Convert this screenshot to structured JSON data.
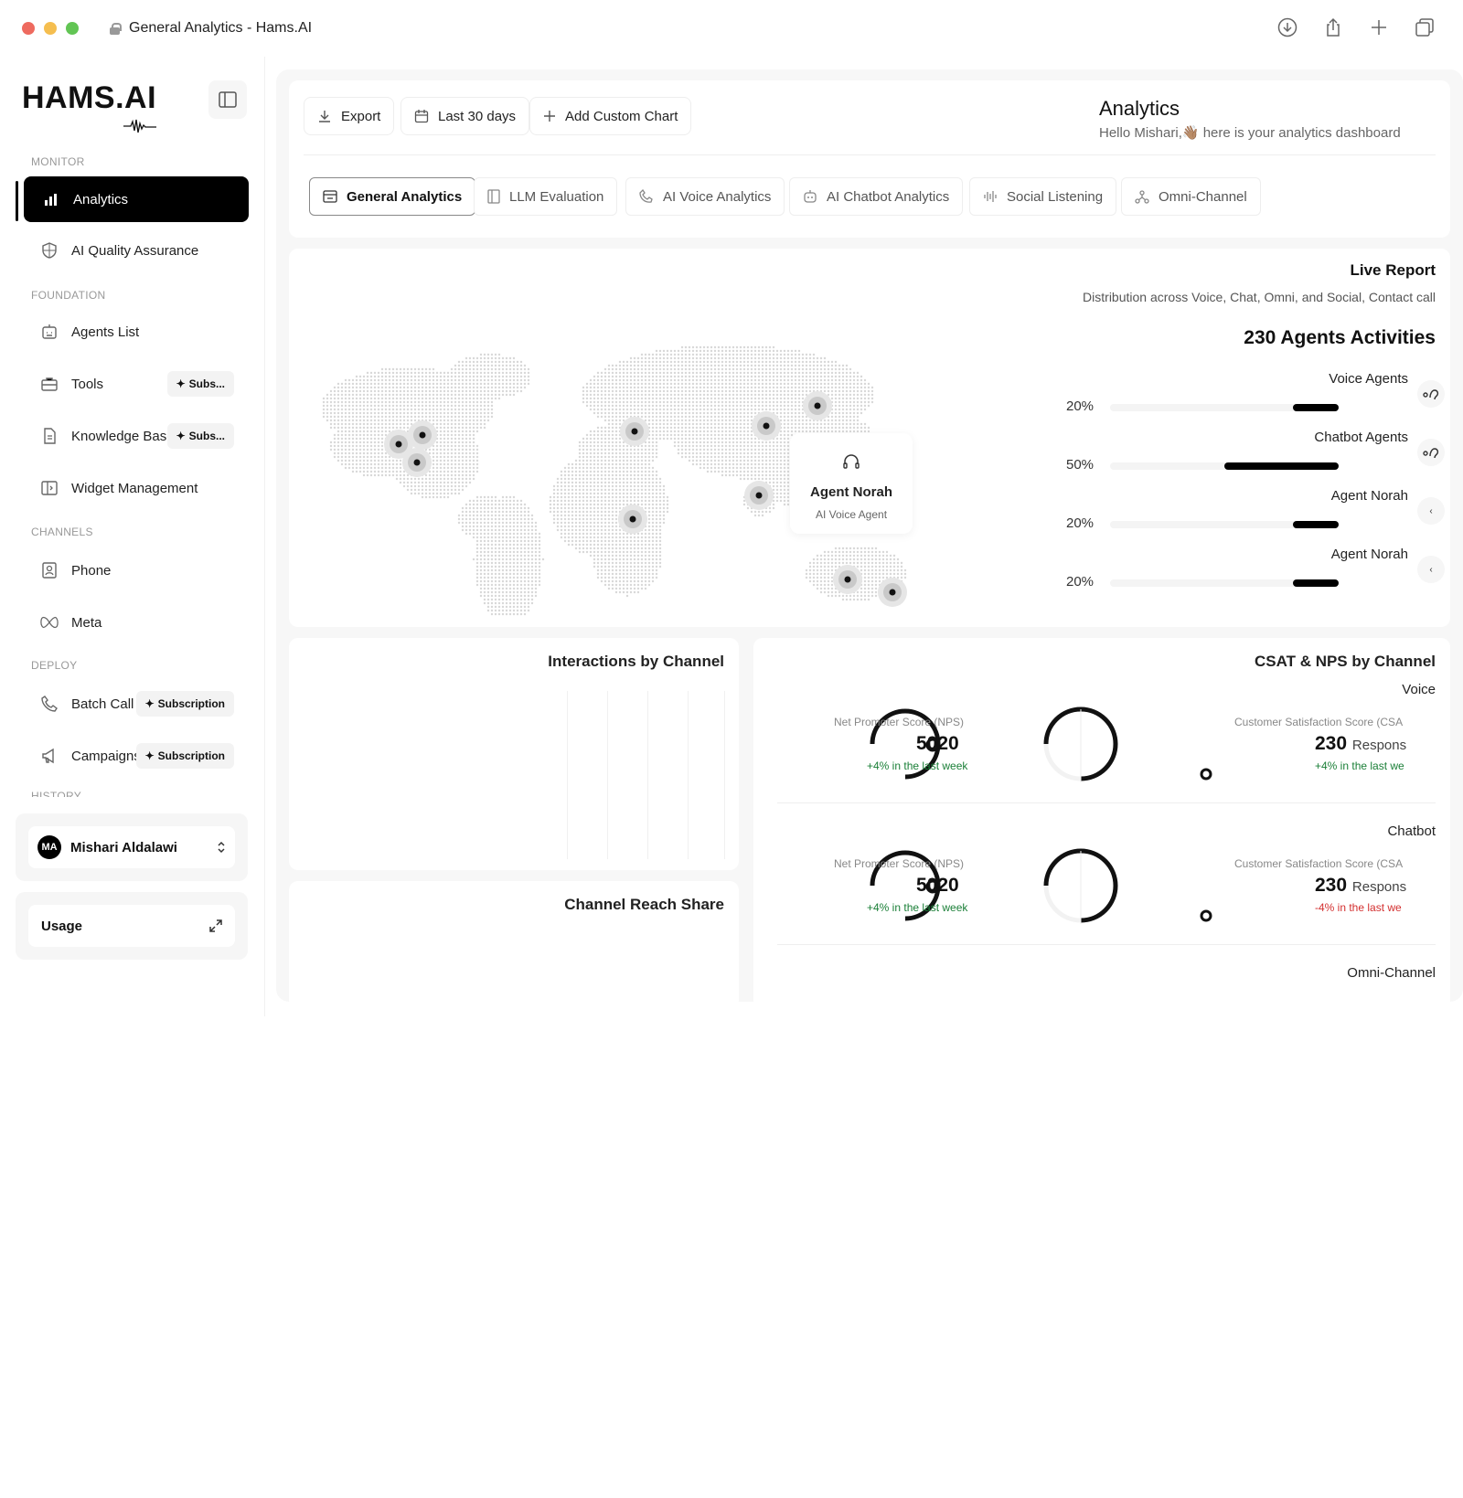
{
  "window": {
    "title": "General Analytics - Hams.AI"
  },
  "brand": {
    "logo": "HAMS.AI"
  },
  "sidebar": {
    "sections": {
      "monitor": "MONITOR",
      "foundation": "FOUNDATION",
      "channels": "CHANNELS",
      "deploy": "DEPLOY",
      "history": "HISTORY"
    },
    "items": {
      "analytics": "Analytics",
      "qa": "AI Quality Assurance",
      "agents": "Agents List",
      "tools": "Tools",
      "kb": "Knowledge Bases",
      "widget": "Widget Management",
      "phone": "Phone",
      "meta": "Meta",
      "batch": "Batch Call",
      "campaigns": "Campaigns"
    },
    "badges": {
      "subs_short": "Subs...",
      "subscription": "Subscription"
    },
    "user": {
      "initials": "MA",
      "name": "Mishari Aldalawi"
    },
    "usage": "Usage"
  },
  "toolbar": {
    "export": "Export",
    "range": "Last 30 days",
    "add_chart": "Add Custom Chart",
    "title": "Analytics",
    "subtitle": "Hello Mishari,👋🏽 here is your analytics dashboard"
  },
  "tabs": {
    "general": "General Analytics",
    "llm": "LLM  Evaluation",
    "voice": "AI Voice Analytics",
    "chatbot": "AI Chatbot Analytics",
    "social": "Social Listening",
    "omni": "Omni-Channel"
  },
  "live_report": {
    "title": "Live Report",
    "subtitle": "Distribution across Voice, Chat, Omni, and Social, Contact call",
    "activities": "230 Agents Activities",
    "agents": [
      {
        "name": "Voice Agents",
        "pct_label": "20%",
        "share": 0.2
      },
      {
        "name": "Chatbot Agents",
        "pct_label": "50%",
        "share": 0.5
      },
      {
        "name": "Agent Norah",
        "pct_label": "20%",
        "share": 0.2
      },
      {
        "name": "Agent Norah",
        "pct_label": "20%",
        "share": 0.2
      }
    ],
    "tooltip": {
      "name": "Agent Norah",
      "role": "AI Voice Agent"
    }
  },
  "interactions": {
    "title": "Interactions by Channel"
  },
  "reach": {
    "title": "Channel Reach Share"
  },
  "csat": {
    "title": "CSAT & NPS by Channel",
    "voice": {
      "label": "Voice",
      "nps_label": "Net Promoter Score (NPS)",
      "nps_value": "5020",
      "nps_delta": "+4% in the last week",
      "csat_label": "Customer Satisfaction Score (CSA",
      "csat_value": "230",
      "csat_unit": "Respons",
      "csat_delta": "+4% in the last we"
    },
    "chatbot": {
      "label": "Chatbot",
      "nps_label": "Net Promoter Score (NPS)",
      "nps_value": "5020",
      "nps_delta": "+4% in the last week",
      "csat_label": "Customer Satisfaction Score (CSA",
      "csat_value": "230",
      "csat_unit": "Respons",
      "csat_delta": "-4% in the last we"
    },
    "omni": {
      "label": "Omni-Channel"
    }
  }
}
